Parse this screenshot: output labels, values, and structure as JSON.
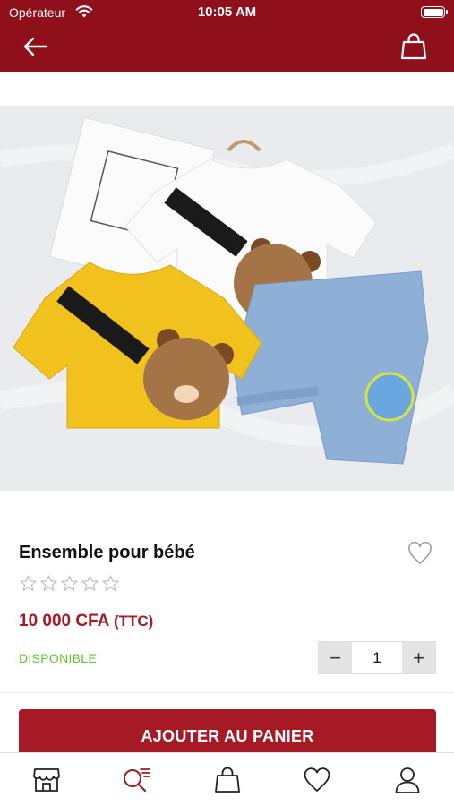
{
  "status_bar": {
    "carrier": "Opérateur",
    "time": "10:05 AM"
  },
  "nav": {
    "back_icon": "arrow-left-icon",
    "cart_icon": "shopping-bag-icon"
  },
  "product": {
    "image_alt_icon": "product-photo",
    "name": "Ensemble pour bébé",
    "rating": 0,
    "rating_max": 5,
    "price": "10 000 CFA",
    "price_suffix": "(TTC)",
    "availability": "DISPONIBLE",
    "quantity": "1"
  },
  "actions": {
    "add_to_cart": "AJOUTER AU PANIER",
    "decrement": "−",
    "increment": "+"
  },
  "tabbar": {
    "items": [
      {
        "icon": "store-icon",
        "active": false
      },
      {
        "icon": "search-list-icon",
        "active": true
      },
      {
        "icon": "shopping-bag-icon",
        "active": false
      },
      {
        "icon": "heart-icon",
        "active": false
      },
      {
        "icon": "user-icon",
        "active": false
      }
    ]
  },
  "colors": {
    "brand": "#8f101a",
    "accent": "#a51a25",
    "available": "#63c22d"
  }
}
